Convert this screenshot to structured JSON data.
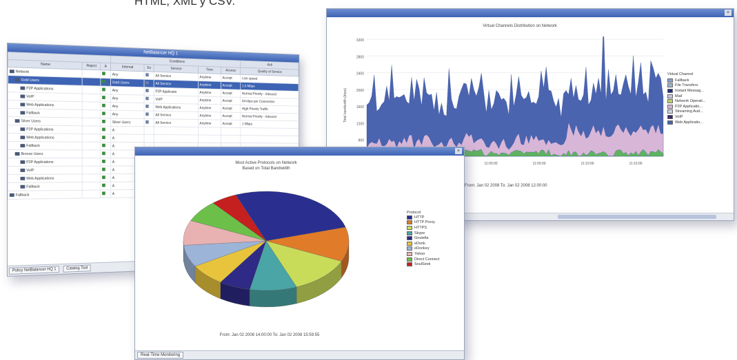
{
  "caption": "HTML, XML y CSV.",
  "policy_window": {
    "title": "NetBalancer HQ 1",
    "group_headers": [
      "Conditions",
      "Acti"
    ],
    "columns": [
      "Name",
      "Reject",
      "A",
      "Internal",
      "Ex",
      "Service",
      "Time",
      "Access",
      "Quality of Service"
    ],
    "rows": [
      {
        "name": "Network",
        "internal": "Any",
        "service": "All Service",
        "time": "Anytime",
        "access": "Accept",
        "qos": "Line speed",
        "indent": 0
      },
      {
        "name": "Gold Users",
        "internal": "Gold Users",
        "service": "All Service",
        "time": "Anytime",
        "access": "Accept",
        "qos": "1.5 Mbps",
        "indent": 1,
        "selected": true
      },
      {
        "name": "P2P Applications",
        "internal": "Any",
        "service": "P2P Applicatio",
        "time": "Anytime",
        "access": "Accept",
        "qos": "Normal Priority - Inbound",
        "indent": 2
      },
      {
        "name": "VoIP",
        "internal": "Any",
        "service": "VoIP",
        "time": "Anytime",
        "access": "Accept",
        "qos": "64 kbps per Connection",
        "indent": 2
      },
      {
        "name": "Web Applications",
        "internal": "Any",
        "service": "Web Applications",
        "time": "Anytime",
        "access": "Accept",
        "qos": "High Priority Traffic",
        "indent": 2
      },
      {
        "name": "Fallback",
        "internal": "Any",
        "service": "All Service",
        "time": "Anytime",
        "access": "Accept",
        "qos": "Normal Priority - Inbound",
        "indent": 2
      },
      {
        "name": "Silver Users",
        "internal": "Silver Users",
        "service": "All Service",
        "time": "Anytime",
        "access": "Accept",
        "qos": "1 Mbps",
        "indent": 1
      },
      {
        "name": "P2P Applications",
        "internal": "A",
        "service": "",
        "time": "",
        "access": "",
        "qos": "",
        "indent": 2
      },
      {
        "name": "Web Applications",
        "internal": "A",
        "service": "",
        "time": "",
        "access": "",
        "qos": "",
        "indent": 2
      },
      {
        "name": "Fallback",
        "internal": "A",
        "service": "",
        "time": "",
        "access": "",
        "qos": "",
        "indent": 2
      },
      {
        "name": "Bronze Users",
        "internal": "A",
        "service": "",
        "time": "",
        "access": "",
        "qos": "",
        "indent": 1
      },
      {
        "name": "P2P Applications",
        "internal": "A",
        "service": "",
        "time": "",
        "access": "",
        "qos": "",
        "indent": 2
      },
      {
        "name": "VoIP",
        "internal": "A",
        "service": "",
        "time": "",
        "access": "",
        "qos": "",
        "indent": 2
      },
      {
        "name": "Web Applications",
        "internal": "A",
        "service": "",
        "time": "",
        "access": "",
        "qos": "",
        "indent": 2
      },
      {
        "name": "Fallback",
        "internal": "A",
        "service": "",
        "time": "",
        "access": "",
        "qos": "",
        "indent": 2
      },
      {
        "name": "Fallback",
        "internal": "A",
        "service": "",
        "time": "",
        "access": "",
        "qos": "",
        "indent": 0
      }
    ],
    "tabs": [
      "Policy NetBalancer HQ 1",
      "Catalog Tool"
    ]
  },
  "area_window": {
    "title": "Virtual Channels Distribution on Network",
    "ylabel": "Total bandwidth (kbps)",
    "yticks": [
      "3200",
      "2800",
      "2400",
      "2000",
      "1600",
      "1200",
      "800"
    ],
    "xticks": [
      "11:00:00",
      "11:05:00",
      "11:10:00",
      "11:15:00"
    ],
    "footer": "From: Jan 02 2008 To: Jan 02 2008 12:00:00",
    "legend_title": "Virtual Channel",
    "legend": [
      {
        "label": "Fallback",
        "color": "#8aa1c8"
      },
      {
        "label": "File Transfers",
        "color": "#9fb2cf"
      },
      {
        "label": "Instant Messag...",
        "color": "#1e2f7a"
      },
      {
        "label": "Mail",
        "color": "#c7c7e2"
      },
      {
        "label": "Network Operati...",
        "color": "#b9d36a"
      },
      {
        "label": "P2P Applicatio...",
        "color": "#d8b6d8"
      },
      {
        "label": "Streaming Aud...",
        "color": "#c8d6ea"
      },
      {
        "label": "VoIP",
        "color": "#3b2a6e"
      },
      {
        "label": "Web Applicatio...",
        "color": "#4a64b0"
      }
    ],
    "colors": {
      "web": "#4a64b0",
      "p2p": "#d8b6d8",
      "fallback": "#8aa1c8",
      "network": "#5fb35f",
      "other": "#e8a0a0",
      "streaming": "#c8d6ea"
    }
  },
  "pie_window": {
    "title_line1": "Most Active Protocols on Network",
    "title_line2": "Based on Total Bandwidth",
    "footer": "From: Jan 02 2008 14:00:00 To: Jan 02 2008 15:59:55",
    "tab": "Real-Time Monitoring",
    "legend_title": "Protocol"
  },
  "chart_data": {
    "type": "pie",
    "categories": [
      "HTTP",
      "HTTP Proxy",
      "HTTPS",
      "Skype",
      "Gnutella",
      "eDonk",
      "eDonkey",
      "Yahoo",
      "Direct Connect",
      "SoulSeek"
    ],
    "values": [
      26,
      11,
      12,
      9,
      6,
      7,
      7,
      8,
      7,
      5
    ],
    "colors": [
      "#2a2f8f",
      "#e07b2a",
      "#c9dc5a",
      "#4aa6a6",
      "#2e2a86",
      "#e8c43c",
      "#9cb4d8",
      "#e8b2b2",
      "#6cc04a",
      "#c4201f"
    ]
  }
}
